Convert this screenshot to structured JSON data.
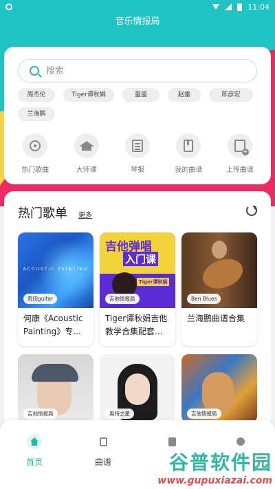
{
  "status_bar": {
    "time": "11:04"
  },
  "app": {
    "title": "音乐情报局"
  },
  "search": {
    "placeholder": "搜索"
  },
  "tags": [
    "周杰伦",
    "Tiger谭秋娟",
    "蛋蛋",
    "赵雷",
    "陈彦宏",
    "兰海鹏"
  ],
  "quick_links": [
    {
      "label": "热门歌曲",
      "icon": "disc-icon"
    },
    {
      "label": "大师课",
      "icon": "graduation-cap-icon"
    },
    {
      "label": "琴报",
      "icon": "newspaper-icon"
    },
    {
      "label": "我的曲谱",
      "icon": "book-icon"
    },
    {
      "label": "上传曲谱",
      "icon": "upload-score-icon"
    }
  ],
  "popular": {
    "title": "热门歌单",
    "more": "更多",
    "albums": [
      {
        "badge": "雨田guitar",
        "title": "何康《Acoustic Painting》专...",
        "cover_text": "ACOUSTIC PAINTING"
      },
      {
        "badge": "吉他情报局",
        "title": "Tiger谭秋娟吉他教学合集配套...",
        "cover_text1": "吉他弹唱",
        "cover_text2": "入门课",
        "cover_text3": "Tiger谭秋娟"
      },
      {
        "badge": "Ben Blues",
        "title": "兰海鹏曲谱合集"
      },
      {
        "badge": "吉他情报局",
        "title": ""
      },
      {
        "badge": "奥特之星",
        "title": ""
      },
      {
        "badge": "吉他情报局",
        "title": ""
      }
    ]
  },
  "bottom_nav": [
    {
      "label": "首页",
      "active": true
    },
    {
      "label": "曲谱",
      "active": false
    },
    {
      "label": "",
      "active": false
    },
    {
      "label": "",
      "active": false
    }
  ],
  "watermark": {
    "main": "谷普软件园",
    "url": "www.gupuxiazai.com"
  },
  "colors": {
    "accent": "#2fb7a5",
    "pink": "#ee2a64",
    "teal": "#1fc3c1",
    "yellow": "#f6d24a"
  }
}
